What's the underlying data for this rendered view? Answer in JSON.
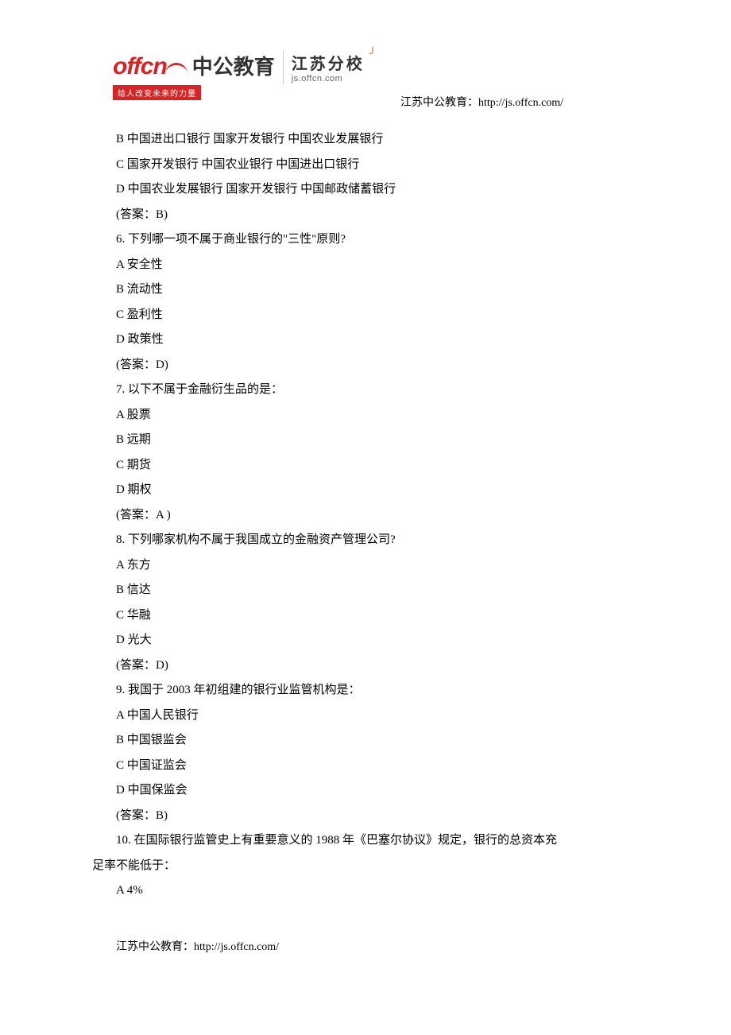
{
  "header": {
    "logo_text": "offcn",
    "logo_cn": "中公教育",
    "slogan": "给人改变未来的力量",
    "branch": "江苏分校",
    "branch_url": "js.offcn.com",
    "source_label": "江苏中公教育：http://js.offcn.com/"
  },
  "lines": [
    "B 中国进出口银行 国家开发银行 中国农业发展银行",
    "C 国家开发银行 中国农业银行 中国进出口银行",
    "D 中国农业发展银行 国家开发银行 中国邮政储蓄银行",
    "(答案：B)",
    "6. 下列哪一项不属于商业银行的\"三性\"原则?",
    "A 安全性",
    "B 流动性",
    "C 盈利性",
    "D 政策性",
    "(答案：D)",
    "7. 以下不属于金融衍生品的是：",
    "A 股票",
    "B 远期",
    "C 期货",
    "D 期权",
    "(答案：A )",
    "8. 下列哪家机构不属于我国成立的金融资产管理公司?",
    "A 东方",
    "B 信达",
    "C 华融",
    "D 光大",
    "(答案：D)",
    "9. 我国于 2003 年初组建的银行业监管机构是：",
    "A 中国人民银行",
    "B 中国银监会",
    "C 中国证监会",
    "D 中国保监会",
    "(答案：B)"
  ],
  "q10_line1": "10. 在国际银行监管史上有重要意义的 1988 年《巴塞尔协议》规定，银行的总资本充",
  "q10_line2": "足率不能低于：",
  "q10_optA": "A 4%",
  "footer": "江苏中公教育：http://js.offcn.com/"
}
